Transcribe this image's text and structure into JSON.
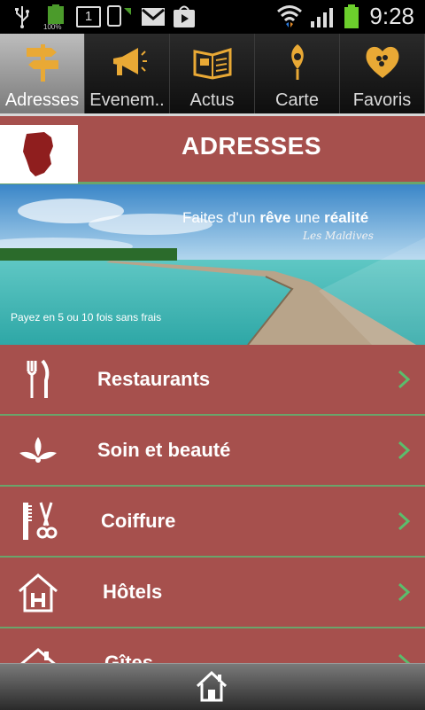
{
  "status_bar": {
    "time": "9:28",
    "battery_text": "100%",
    "sim_badge": "1",
    "icons": [
      "usb-icon",
      "battery-icon",
      "sim-icon",
      "phone-sync-icon",
      "gmail-icon",
      "play-store-icon",
      "wifi-icon",
      "signal-icon",
      "battery-full-icon"
    ]
  },
  "tabs": [
    {
      "label": "Adresses",
      "icon": "signpost-icon",
      "active": true
    },
    {
      "label": "Evenem..",
      "icon": "megaphone-icon",
      "active": false
    },
    {
      "label": "Actus",
      "icon": "newspaper-icon",
      "active": false
    },
    {
      "label": "Carte",
      "icon": "map-pin-icon",
      "active": false
    },
    {
      "label": "Favoris",
      "icon": "heart-icon",
      "active": false
    }
  ],
  "header": {
    "title": "ADRESSES",
    "logo": "guyane-map-icon"
  },
  "banner": {
    "headline_1": "Faites d'un ",
    "headline_2": "rêve",
    "headline_3": " une ",
    "headline_4": "réalité",
    "subline": "Les Maldives",
    "footer": "Payez en 5 ou 10 fois sans frais"
  },
  "menu": {
    "items": [
      {
        "label": "Restaurants",
        "icon": "fork-knife-icon"
      },
      {
        "label": "Soin et beauté",
        "icon": "lotus-icon"
      },
      {
        "label": "Coiffure",
        "icon": "comb-scissors-icon"
      },
      {
        "label": "Hôtels",
        "icon": "hotel-icon"
      },
      {
        "label": "Gîtes",
        "icon": "house-icon"
      }
    ]
  },
  "bottom_bar": {
    "icon": "home-icon"
  },
  "colors": {
    "row_bg": "#a6504d",
    "separator": "#6aa56b",
    "tab_icon": "#e9a935",
    "chevron": "#5bbd6c"
  }
}
